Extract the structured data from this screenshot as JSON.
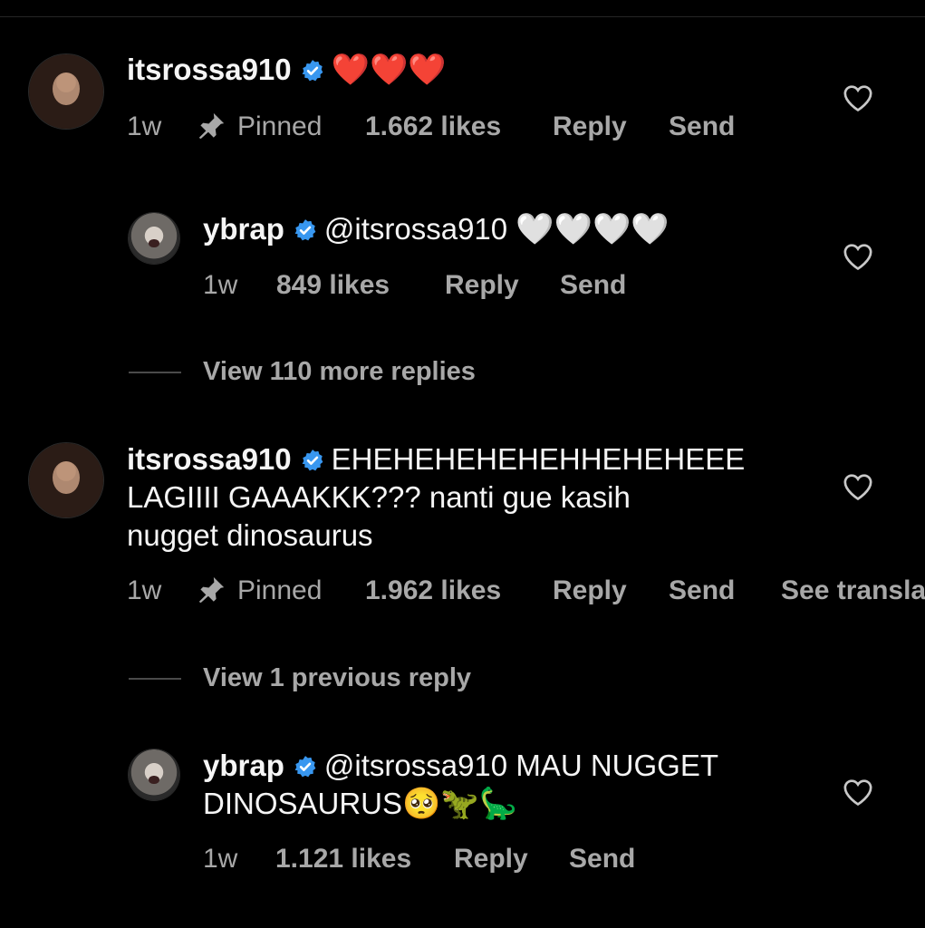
{
  "comments": [
    {
      "username": "itsrossa910",
      "text": "",
      "emoji": "❤️❤️❤️",
      "time": "1w",
      "pinned_label": "Pinned",
      "likes": "1.662 likes",
      "reply": "Reply",
      "send": "Send"
    },
    {
      "username": "ybrap",
      "mention": "@itsrossa910",
      "emoji": "🤍🤍🤍🤍",
      "time": "1w",
      "likes": "849 likes",
      "reply": "Reply",
      "send": "Send"
    },
    {
      "view_more": "View 110 more replies"
    },
    {
      "username": "itsrossa910",
      "line1": "EHEHEHEHEHEHHEHEHEEE",
      "line2": "LAGIIII GAAAKKK??? nanti gue kasih",
      "line3": "nugget dinosaurus",
      "time": "1w",
      "pinned_label": "Pinned",
      "likes": "1.962 likes",
      "reply": "Reply",
      "send": "Send",
      "see_translation": "See translation"
    },
    {
      "view_previous": "View 1 previous reply"
    },
    {
      "username": "ybrap",
      "mention": "@itsrossa910",
      "line1": "MAU NUGGET",
      "line2": "DINOSAURUS",
      "emoji": "🥺🦖🦕",
      "time": "1w",
      "likes": "1.121 likes",
      "reply": "Reply",
      "send": "Send"
    }
  ],
  "colors": {
    "background": "#000000",
    "text": "#f5f5f5",
    "secondary": "#a8a8a8",
    "verified": "#3897f0"
  }
}
